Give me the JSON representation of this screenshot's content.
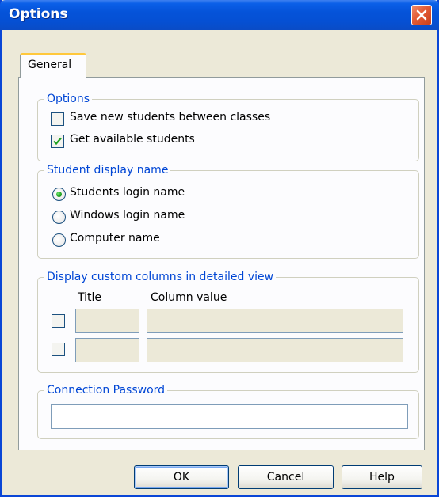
{
  "window": {
    "title": "Options"
  },
  "tabs": [
    {
      "label": "General"
    }
  ],
  "options_group": {
    "legend": "Options",
    "items": [
      {
        "label": "Save new students between classes",
        "checked": false
      },
      {
        "label": "Get available students",
        "checked": true
      }
    ]
  },
  "display_name_group": {
    "legend": "Student display name",
    "items": [
      {
        "label": "Students login name",
        "selected": true
      },
      {
        "label": "Windows login name",
        "selected": false
      },
      {
        "label": "Computer name",
        "selected": false
      }
    ]
  },
  "custom_columns_group": {
    "legend": "Display custom columns in detailed view",
    "col_title": "Title",
    "col_value": "Column value",
    "rows": [
      {
        "checked": false,
        "title": "",
        "value": ""
      },
      {
        "checked": false,
        "title": "",
        "value": ""
      }
    ]
  },
  "password_group": {
    "legend": "Connection Password",
    "value": ""
  },
  "buttons": {
    "ok": "OK",
    "cancel": "Cancel",
    "help": "Help"
  },
  "colors": {
    "titlebar": "#0553d9",
    "legend_text": "#0046d5",
    "tab_highlight": "#ffc83c",
    "close_button": "#e35a34"
  }
}
